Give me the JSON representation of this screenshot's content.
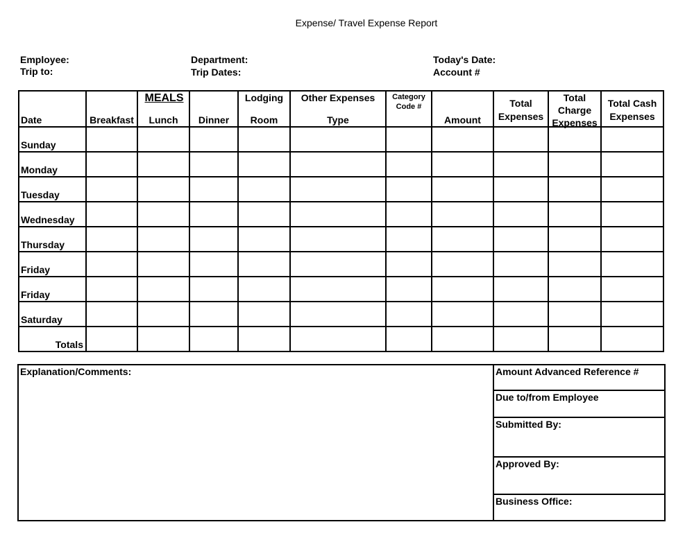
{
  "document": {
    "title": "Expense/ Travel Expense Report"
  },
  "fields": {
    "employee": "Employee:",
    "trip_to": "Trip to:",
    "department": "Department:",
    "trip_dates": "Trip Dates:",
    "todays_date": "Today's Date:",
    "account": "Account #"
  },
  "table": {
    "headers": {
      "date": "Date",
      "breakfast": "Breakfast",
      "meals": "MEALS",
      "lunch": "Lunch",
      "dinner": "Dinner",
      "lodging": "Lodging",
      "room": "Room",
      "other_expenses": "Other Expenses",
      "type": "Type",
      "category": "Category",
      "code": "Code #",
      "amount": "Amount",
      "total_expenses_1": "Total",
      "total_expenses_2": "Expenses",
      "total_charge_1": "Total",
      "total_charge_2": "Charge",
      "total_charge_3": "Expenses",
      "total_cash_1": "Total Cash",
      "total_cash_2": "Expenses"
    },
    "rows": [
      {
        "day": "Sunday"
      },
      {
        "day": "Monday"
      },
      {
        "day": "Tuesday"
      },
      {
        "day": "Wednesday"
      },
      {
        "day": "Thursday"
      },
      {
        "day": "Friday"
      },
      {
        "day": "Friday"
      },
      {
        "day": "Saturday"
      }
    ],
    "totals_label": "Totals"
  },
  "bottom": {
    "comments_label": "Explanation/Comments:",
    "amount_advanced": "Amount Advanced Reference #",
    "due_to_from": "Due to/from Employee",
    "submitted_by": "Submitted By:",
    "approved_by": "Approved By:",
    "business_office": "Business Office:"
  }
}
